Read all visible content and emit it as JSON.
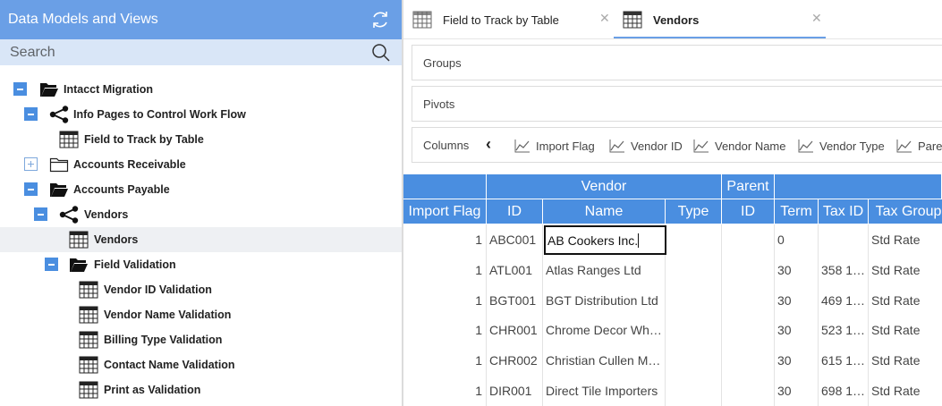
{
  "left_panel": {
    "title": "Data Models and Views",
    "search_placeholder": "Search",
    "tree": [
      {
        "label": "Intacct Migration",
        "control": "minus",
        "icon": "folder-open-icon"
      },
      {
        "label": "Info Pages to Control Work Flow",
        "control": "minus",
        "icon": "share-nodes-icon"
      },
      {
        "label": "Field to Track by Table",
        "control": "",
        "icon": "grid-table-icon"
      },
      {
        "label": "Accounts Receivable",
        "control": "plus",
        "icon": "folder-closed-icon"
      },
      {
        "label": "Accounts Payable",
        "control": "minus",
        "icon": "folder-open-icon"
      },
      {
        "label": "Vendors",
        "control": "minus",
        "icon": "share-nodes-icon"
      },
      {
        "label": "Vendors",
        "control": "",
        "icon": "grid-table-icon",
        "selected": true
      },
      {
        "label": "Field Validation",
        "control": "minus",
        "icon": "folder-open-icon"
      },
      {
        "label": "Vendor ID Validation",
        "control": "",
        "icon": "grid-table-icon"
      },
      {
        "label": "Vendor Name Validation",
        "control": "",
        "icon": "grid-table-icon"
      },
      {
        "label": "Billing Type Validation",
        "control": "",
        "icon": "grid-table-icon"
      },
      {
        "label": "Contact Name Validation",
        "control": "",
        "icon": "grid-table-icon"
      },
      {
        "label": "Print as Validation",
        "control": "",
        "icon": "grid-table-icon"
      }
    ]
  },
  "tabs": [
    {
      "label": "Field to Track by Table",
      "active": false
    },
    {
      "label": "Vendors",
      "active": true
    }
  ],
  "zones": {
    "groups_label": "Groups",
    "pivots_label": "Pivots",
    "columns_label": "Columns",
    "columns": [
      "Import Flag",
      "Vendor ID",
      "Vendor Name",
      "Vendor Type",
      "Parent"
    ]
  },
  "grid": {
    "group_headers": [
      "Vendor",
      "Parent"
    ],
    "columns": [
      "Import Flag",
      "ID",
      "Name",
      "Type",
      "ID",
      "Term",
      "Tax ID",
      "Tax Group"
    ],
    "rows": [
      {
        "import_flag": "1",
        "id": "ABC001",
        "name": "AB Cookers Inc.",
        "type": "",
        "parent_id": "",
        "term": "0",
        "tax_id": "",
        "tax_group": "Std Rate"
      },
      {
        "import_flag": "1",
        "id": "ATL001",
        "name": "Atlas Ranges Ltd",
        "type": "",
        "parent_id": "",
        "term": "30",
        "tax_id": "358 1…",
        "tax_group": "Std Rate"
      },
      {
        "import_flag": "1",
        "id": "BGT001",
        "name": "BGT Distribution Ltd",
        "type": "",
        "parent_id": "",
        "term": "30",
        "tax_id": "469 1…",
        "tax_group": "Std Rate"
      },
      {
        "import_flag": "1",
        "id": "CHR001",
        "name": "Chrome Decor Wh…",
        "type": "",
        "parent_id": "",
        "term": "30",
        "tax_id": "523 1…",
        "tax_group": "Std Rate"
      },
      {
        "import_flag": "1",
        "id": "CHR002",
        "name": "Christian Cullen M…",
        "type": "",
        "parent_id": "",
        "term": "30",
        "tax_id": "615 1…",
        "tax_group": "Std Rate"
      },
      {
        "import_flag": "1",
        "id": "DIR001",
        "name": "Direct Tile Importers",
        "type": "",
        "parent_id": "",
        "term": "30",
        "tax_id": "698 1…",
        "tax_group": "Std Rate"
      }
    ],
    "editing_value": "AB Cookers Inc."
  },
  "colors": {
    "accent": "#4a8ee0",
    "header_blue": "#6a9fe6",
    "search_bg": "#d9e6f7"
  }
}
